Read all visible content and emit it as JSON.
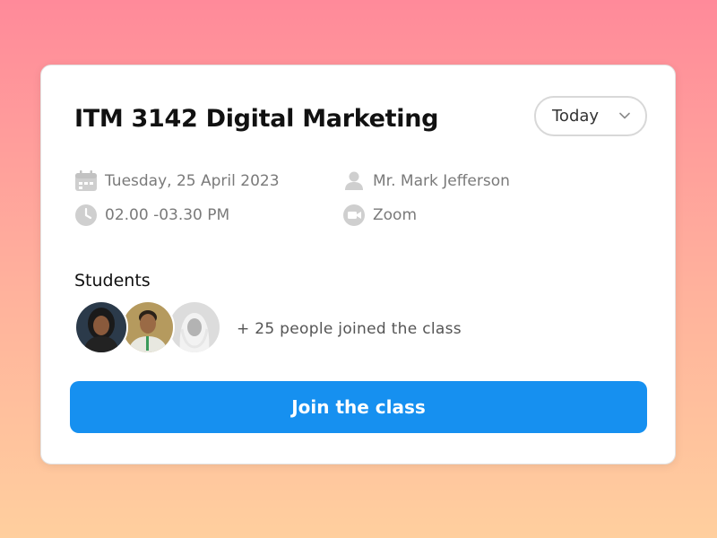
{
  "card": {
    "title": "ITM 3142 Digital Marketing",
    "dropdown": {
      "selected": "Today",
      "icon": "chevron-down-icon"
    },
    "details": {
      "date": "Tuesday, 25 April 2023",
      "date_icon": "calendar-icon",
      "time": "02.00 -03.30 PM",
      "time_icon": "clock-icon",
      "instructor": "Mr. Mark Jefferson",
      "instructor_icon": "user-icon",
      "platform": "Zoom",
      "platform_icon": "video-camera-icon"
    },
    "students": {
      "label": "Students",
      "joined_text": "+ 25 people joined the class"
    },
    "join_button": "Join the class"
  },
  "colors": {
    "accent": "#1690f0",
    "icon_gray": "#cfcfcf",
    "background_top": "#ff8a9a",
    "background_bottom": "#ffcf9e"
  }
}
